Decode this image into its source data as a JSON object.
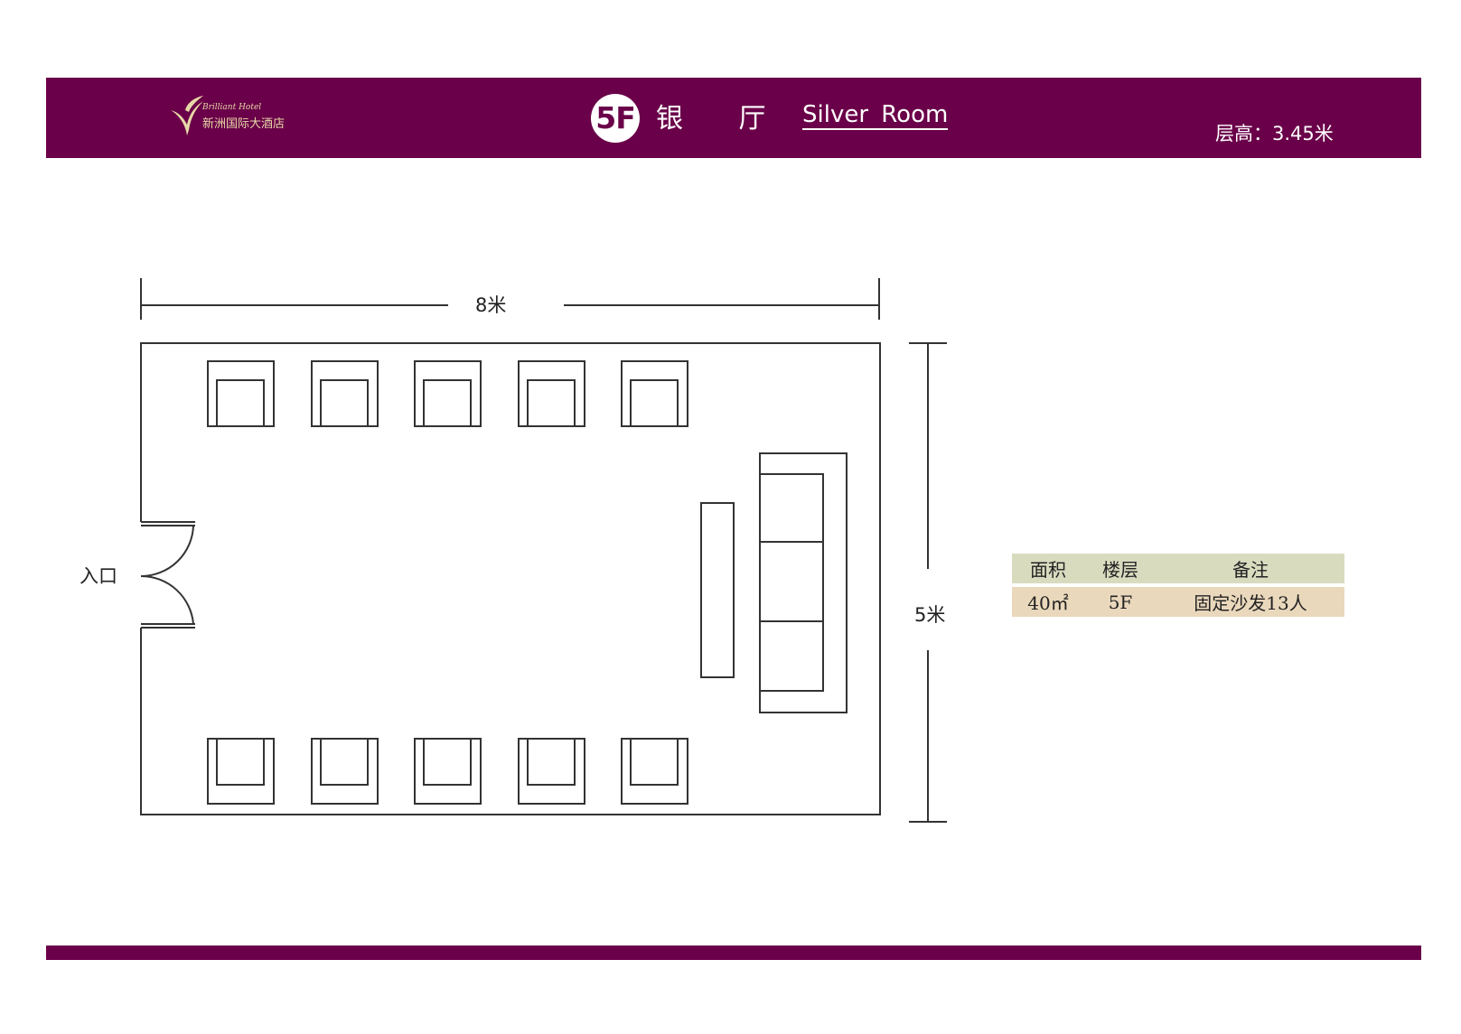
{
  "header": {
    "logo_text_en": "Brilliant Hotel",
    "logo_text_cn": "新洲国际大酒店",
    "floor_badge": "5F",
    "room_name_cn": "银 厅",
    "room_name_en": "Silver Room",
    "ceiling_height": "层高：3.45米"
  },
  "floor_plan": {
    "width_label": "8米",
    "height_label": "5米",
    "entrance_label": "入口",
    "chairs_top_count": 5,
    "chairs_bottom_count": 5,
    "sofa_seats": 3
  },
  "info_table": {
    "headers": [
      "面积",
      "楼层",
      "备注"
    ],
    "row": [
      "40㎡",
      "5F",
      "固定沙发13人"
    ]
  },
  "colors": {
    "brand": "#6a0049",
    "logo_gold": "#e8d9a8",
    "table_header": "#d9dbbf",
    "table_row": "#ead8bc",
    "line": "#333333"
  }
}
